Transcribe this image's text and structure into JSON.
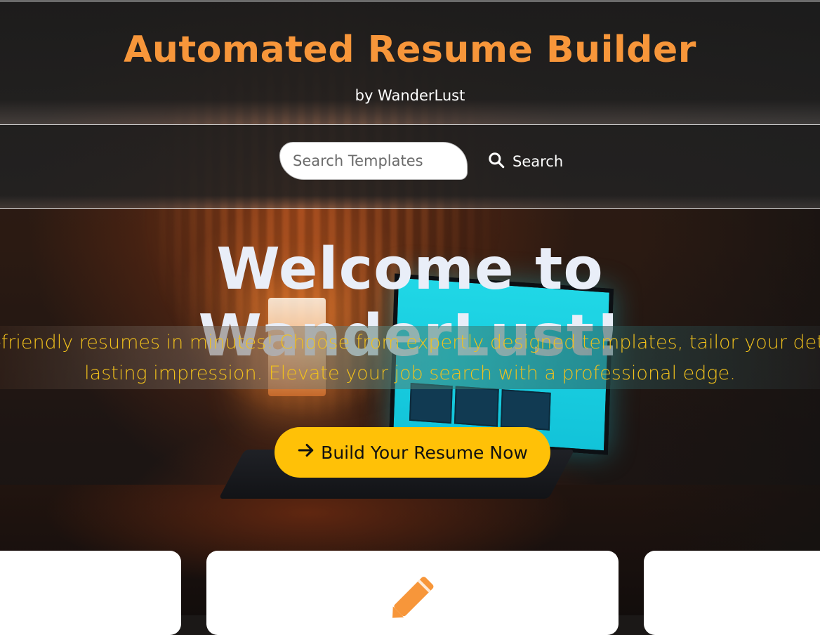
{
  "header": {
    "title": "Automated Resume Builder",
    "byline": "by WanderLust"
  },
  "search": {
    "placeholder": "Search Templates",
    "button_label": "Search",
    "icon": "search-icon"
  },
  "hero": {
    "heading": "Welcome to WanderLust!",
    "tagline_line1": "-friendly resumes in minutes! Choose from expertly designed templates, tailor your details effo",
    "tagline_line2": "lasting impression. Elevate your job search with a professional edge.",
    "cta_label": "Build Your Resume Now",
    "cta_icon": "arrow-right-icon"
  },
  "cards": {
    "middle_icon": "pencil-icon"
  },
  "colors": {
    "title": "#f7963a",
    "tagline": "#f1c11c",
    "cta_background": "#ffc107",
    "welcome_text": "#e9eef8"
  }
}
